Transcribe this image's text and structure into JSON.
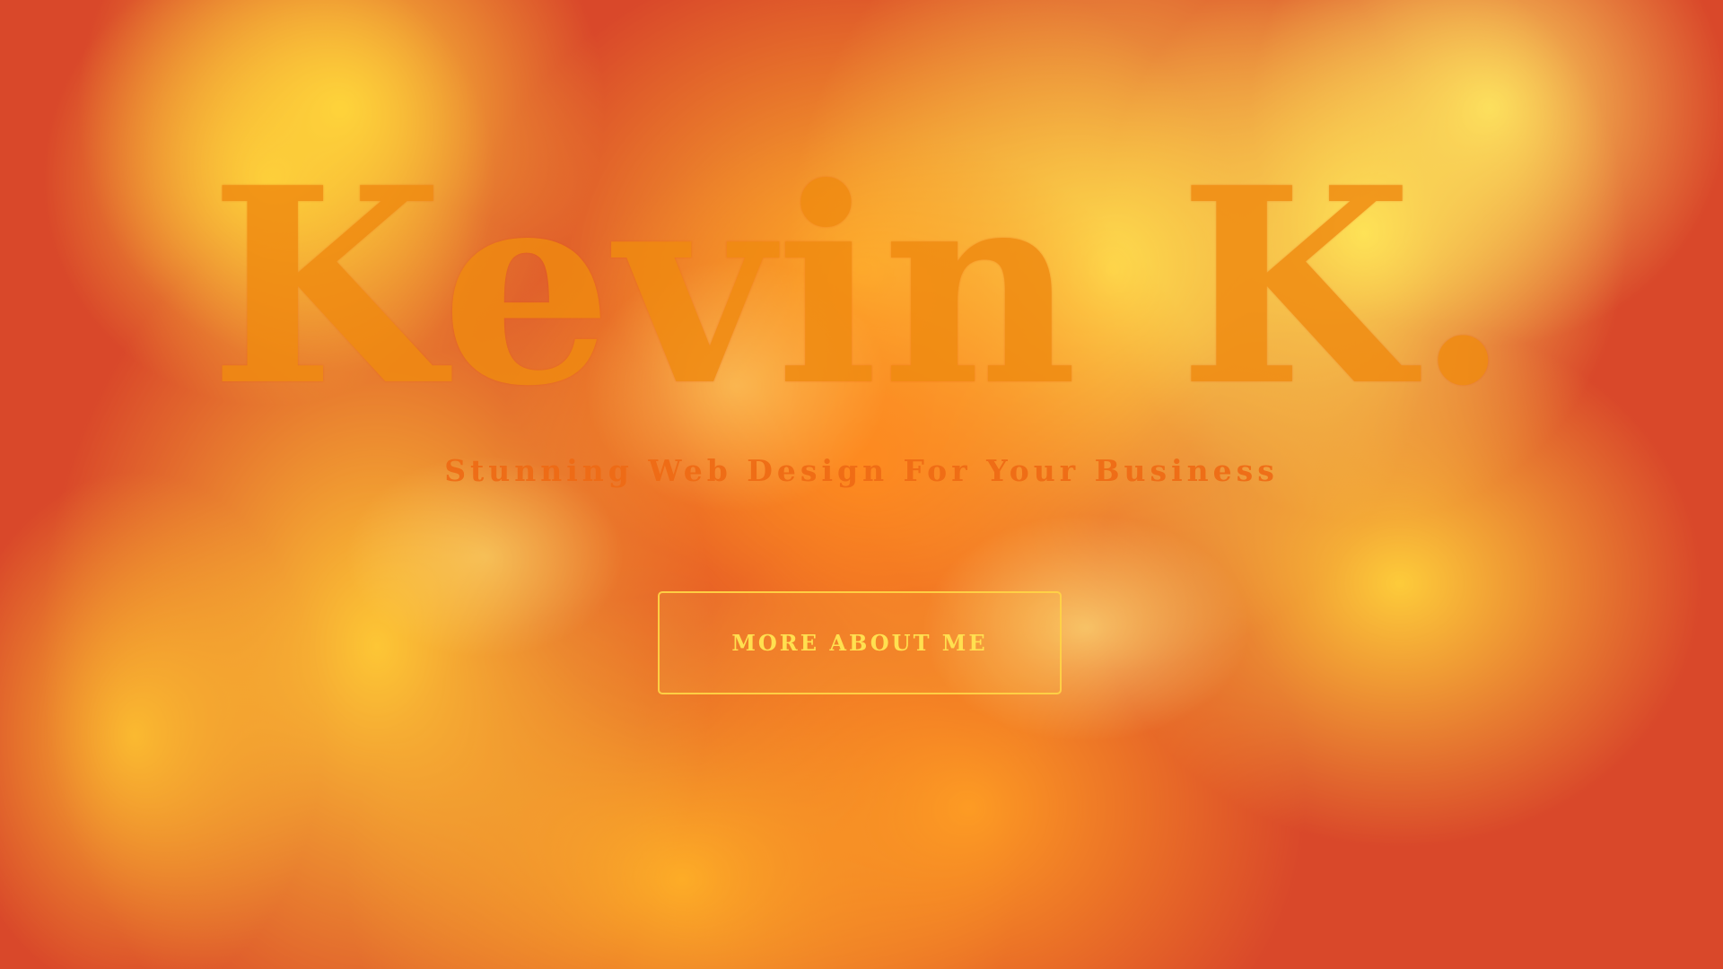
{
  "hero": {
    "title": "Kevin K.",
    "tagline": "Stunning Web Design For Your Business",
    "cta_label": "MORE ABOUT ME"
  },
  "colors": {
    "background": "#d9482a",
    "smoke_yellow": "#ffd045",
    "smoke_orange": "#ff8c28",
    "title": "#f08a10",
    "tagline": "#ef6a14",
    "cta_text": "#ffe050",
    "cta_border": "#ffd246"
  }
}
